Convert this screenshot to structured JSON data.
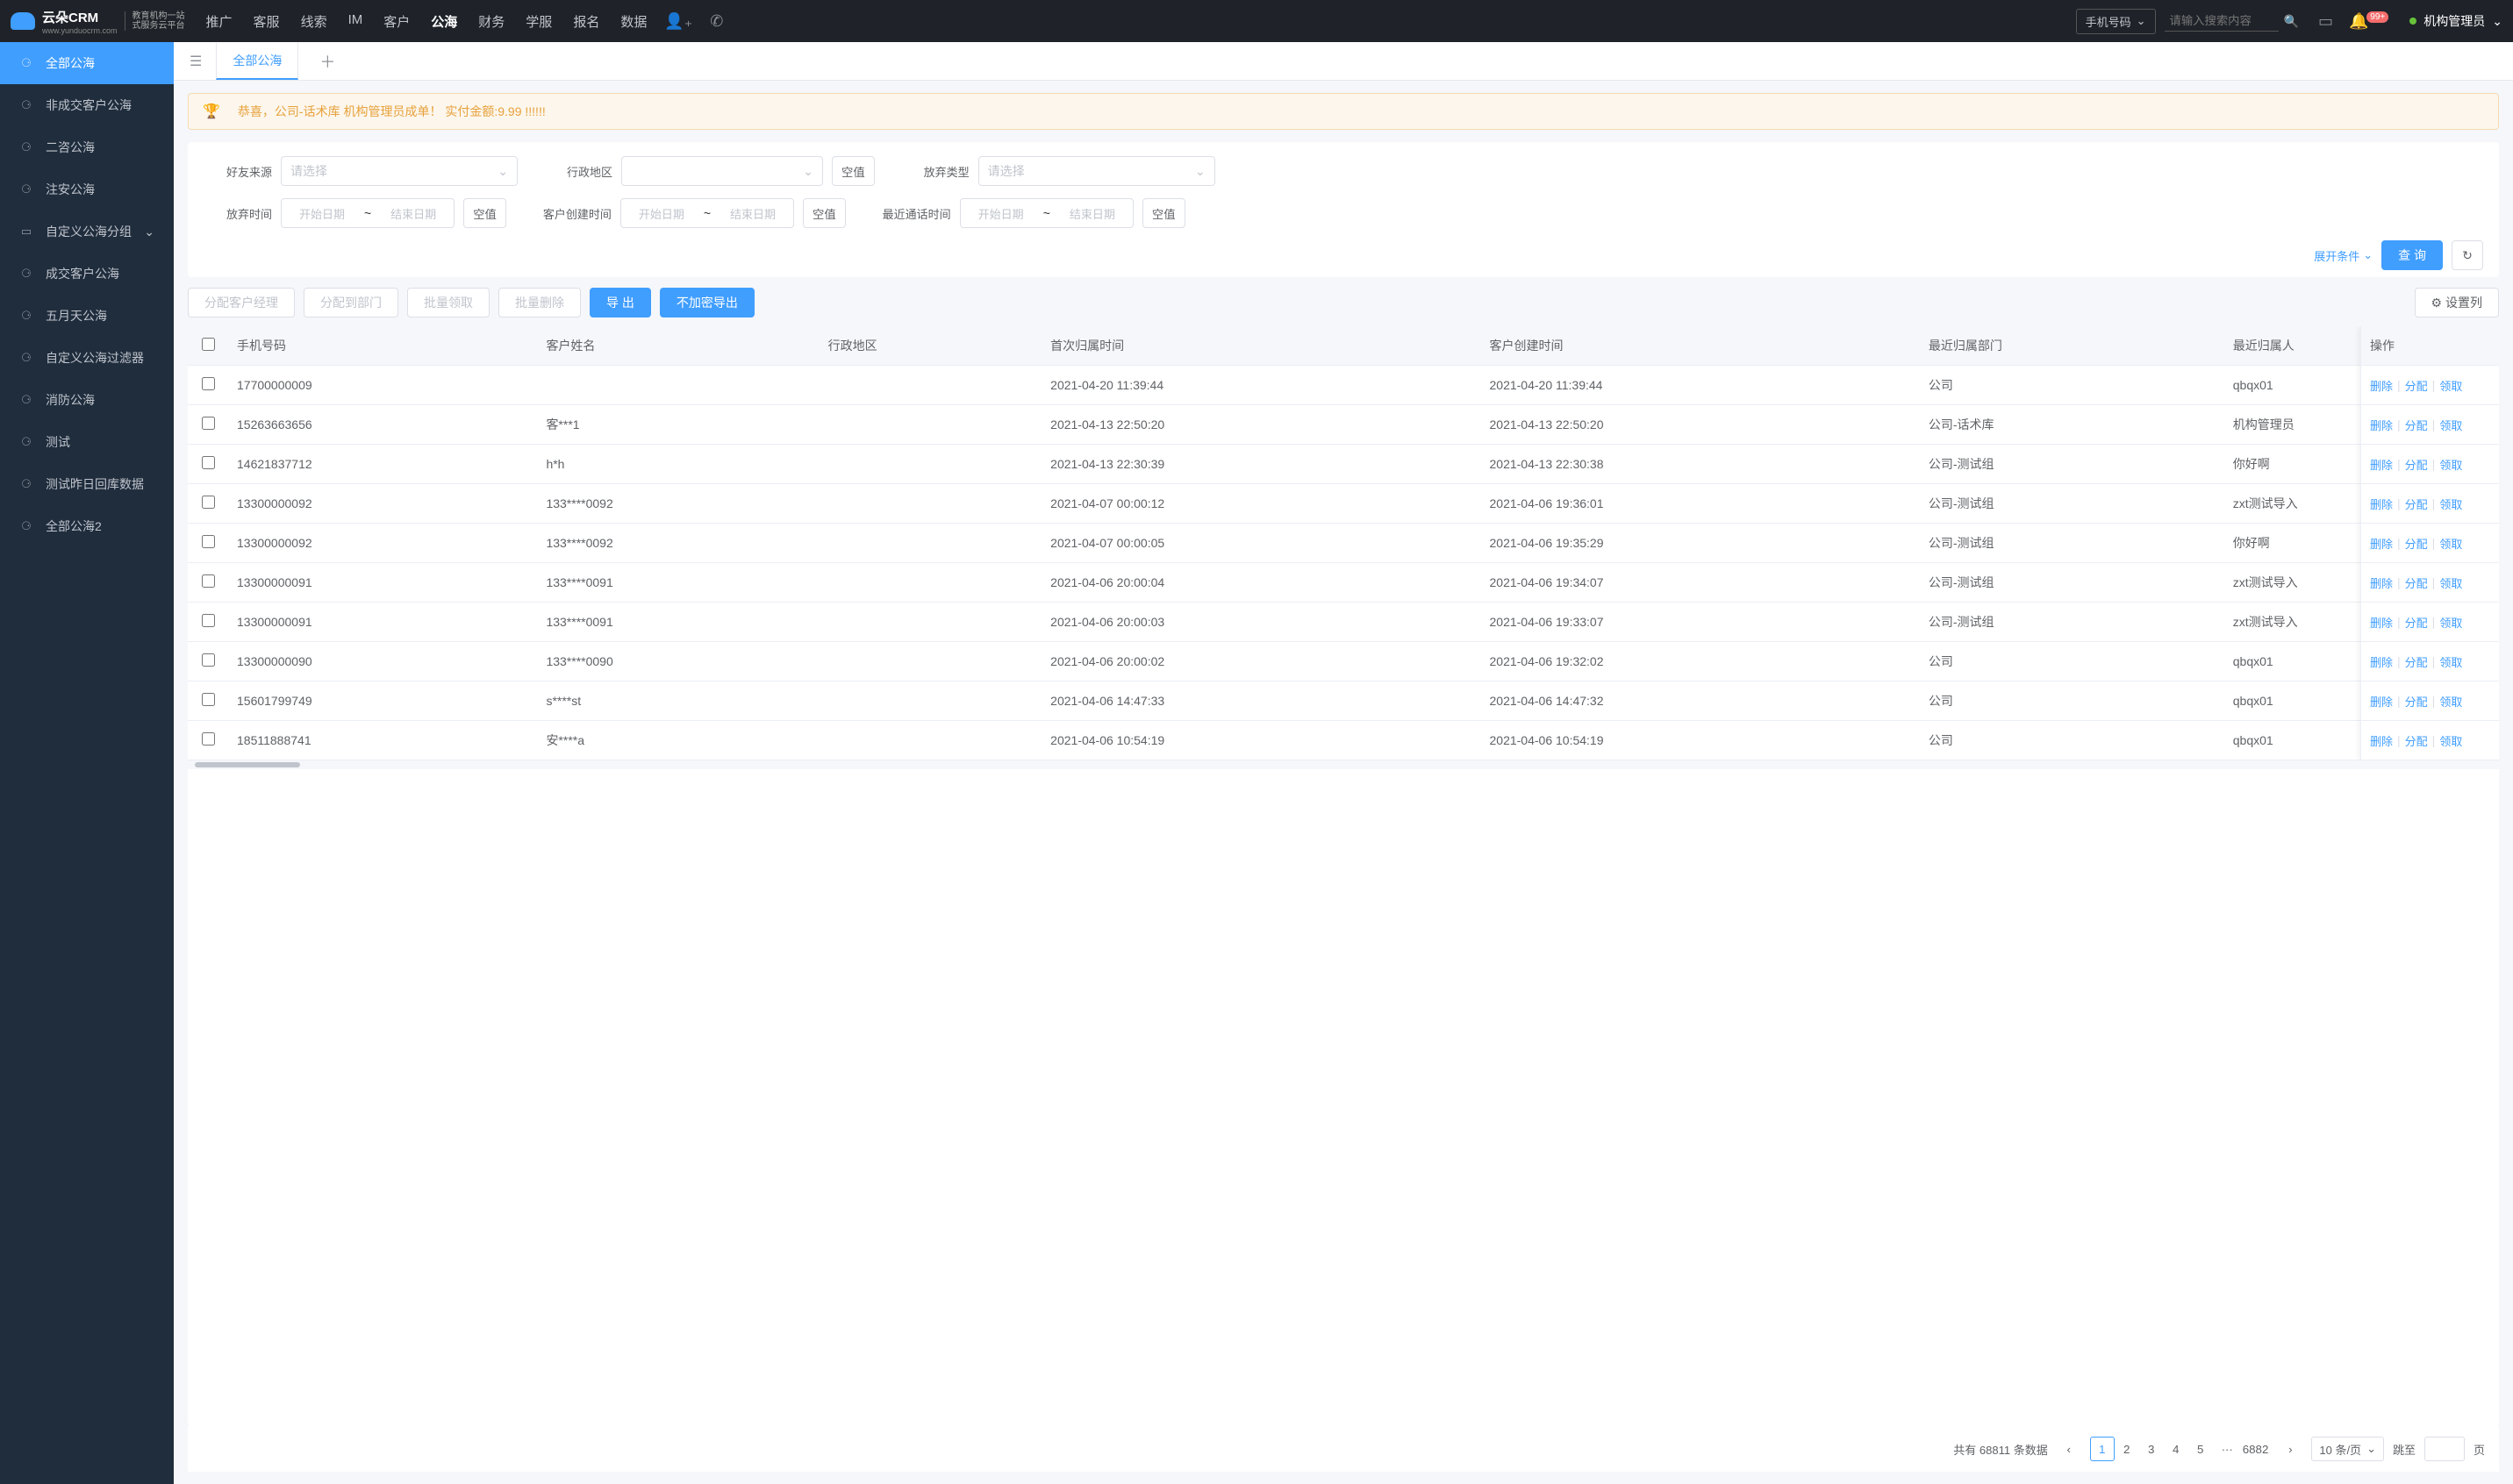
{
  "logo": {
    "title": "云朵CRM",
    "sub1": "教育机构一站",
    "sub2": "式服务云平台",
    "domain": "www.yunduocrm.com"
  },
  "nav": [
    "推广",
    "客服",
    "线索",
    "IM",
    "客户",
    "公海",
    "财务",
    "学服",
    "报名",
    "数据"
  ],
  "nav_active_index": 5,
  "search": {
    "type": "手机号码",
    "placeholder": "请输入搜索内容"
  },
  "notification_badge": "99+",
  "user_name": "机构管理员",
  "sidebar": [
    {
      "label": "全部公海",
      "ic": "⚆"
    },
    {
      "label": "非成交客户公海",
      "ic": "⚆"
    },
    {
      "label": "二咨公海",
      "ic": "⚆"
    },
    {
      "label": "注安公海",
      "ic": "⚆"
    },
    {
      "label": "自定义公海分组",
      "ic": "▭",
      "expand": true
    },
    {
      "label": "成交客户公海",
      "ic": "⚆"
    },
    {
      "label": "五月天公海",
      "ic": "⚆"
    },
    {
      "label": "自定义公海过滤器",
      "ic": "⚆"
    },
    {
      "label": "消防公海",
      "ic": "⚆"
    },
    {
      "label": "测试",
      "ic": "⚆"
    },
    {
      "label": "测试昨日回库数据",
      "ic": "⚆"
    },
    {
      "label": "全部公海2",
      "ic": "⚆"
    }
  ],
  "sidebar_active_index": 0,
  "tab_active": "全部公海",
  "banner": "恭喜，公司-话术库  机构管理员成单！  实付金额:9.99 !!!!!!",
  "filters": {
    "source_label": "好友来源",
    "source_ph": "请选择",
    "region_label": "行政地区",
    "region_null": "空值",
    "type_label": "放弃类型",
    "type_ph": "请选择",
    "abandon_time_label": "放弃时间",
    "abandon_null": "空值",
    "create_time_label": "客户创建时间",
    "create_null": "空值",
    "call_time_label": "最近通话时间",
    "call_null": "空值",
    "start_ph": "开始日期",
    "end_ph": "结束日期",
    "expand": "展开条件",
    "query": "查 询",
    "refresh": "↻"
  },
  "toolbar": {
    "assign_mgr": "分配客户经理",
    "assign_dept": "分配到部门",
    "batch_claim": "批量领取",
    "batch_del": "批量删除",
    "export": "导 出",
    "export_plain": "不加密导出",
    "cols": "设置列"
  },
  "columns": [
    "手机号码",
    "客户姓名",
    "行政地区",
    "首次归属时间",
    "客户创建时间",
    "最近归属部门",
    "最近归属人"
  ],
  "ops_header": "操作",
  "ops": {
    "del": "删除",
    "assign": "分配",
    "claim": "领取"
  },
  "rows": [
    {
      "phone": "17700000009",
      "name": "",
      "region": "",
      "first": "2021-04-20 11:39:44",
      "created": "2021-04-20 11:39:44",
      "dept": "公司",
      "owner": "qbqx01"
    },
    {
      "phone": "15263663656",
      "name": "客***1",
      "region": "",
      "first": "2021-04-13 22:50:20",
      "created": "2021-04-13 22:50:20",
      "dept": "公司-话术库",
      "owner": "机构管理员"
    },
    {
      "phone": "14621837712",
      "name": "h*h",
      "region": "",
      "first": "2021-04-13 22:30:39",
      "created": "2021-04-13 22:30:38",
      "dept": "公司-测试组",
      "owner": "你好啊"
    },
    {
      "phone": "13300000092",
      "name": "133****0092",
      "region": "",
      "first": "2021-04-07 00:00:12",
      "created": "2021-04-06 19:36:01",
      "dept": "公司-测试组",
      "owner": "zxt测试导入"
    },
    {
      "phone": "13300000092",
      "name": "133****0092",
      "region": "",
      "first": "2021-04-07 00:00:05",
      "created": "2021-04-06 19:35:29",
      "dept": "公司-测试组",
      "owner": "你好啊"
    },
    {
      "phone": "13300000091",
      "name": "133****0091",
      "region": "",
      "first": "2021-04-06 20:00:04",
      "created": "2021-04-06 19:34:07",
      "dept": "公司-测试组",
      "owner": "zxt测试导入"
    },
    {
      "phone": "13300000091",
      "name": "133****0091",
      "region": "",
      "first": "2021-04-06 20:00:03",
      "created": "2021-04-06 19:33:07",
      "dept": "公司-测试组",
      "owner": "zxt测试导入"
    },
    {
      "phone": "13300000090",
      "name": "133****0090",
      "region": "",
      "first": "2021-04-06 20:00:02",
      "created": "2021-04-06 19:32:02",
      "dept": "公司",
      "owner": "qbqx01"
    },
    {
      "phone": "15601799749",
      "name": "s****st",
      "region": "",
      "first": "2021-04-06 14:47:33",
      "created": "2021-04-06 14:47:32",
      "dept": "公司",
      "owner": "qbqx01"
    },
    {
      "phone": "18511888741",
      "name": "安****a",
      "region": "",
      "first": "2021-04-06 10:54:19",
      "created": "2021-04-06 10:54:19",
      "dept": "公司",
      "owner": "qbqx01"
    }
  ],
  "pager": {
    "total_prefix": "共有",
    "total": "68811",
    "total_suffix": "条数据",
    "pages": [
      "1",
      "2",
      "3",
      "4",
      "5"
    ],
    "last": "6882",
    "size": "10 条/页",
    "jump": "跳至",
    "page_suffix": "页"
  }
}
